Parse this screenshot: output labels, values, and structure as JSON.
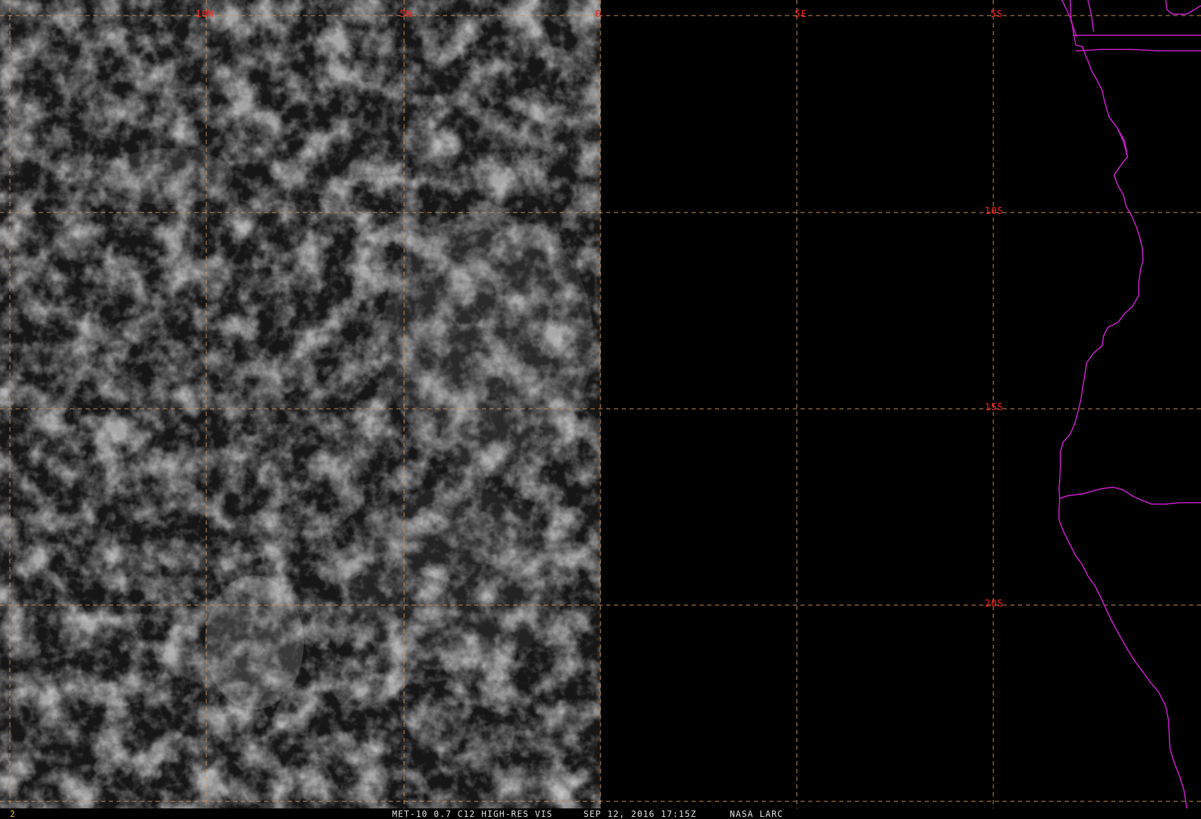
{
  "image": {
    "caption": {
      "frame_number": "2",
      "product": "MET-10 0.7 C12 HIGH-RES VIS",
      "datetime": "SEP 12, 2016 17:15Z",
      "source": "NASA LARC"
    },
    "longitude_labels": [
      "10W",
      "5W",
      "0",
      "5E",
      "5S"
    ],
    "latitude_labels": [
      "10S",
      "15S",
      "20S"
    ],
    "colors": {
      "grid_line": "#c8905a",
      "grid_label": "#ff2020",
      "coastline": "#d020d0",
      "caption_text": "#e0e0e0",
      "background": "#000000"
    }
  }
}
